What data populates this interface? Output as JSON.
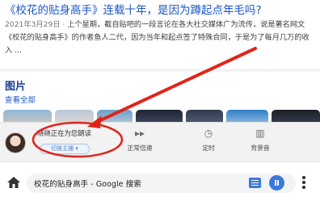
{
  "result": {
    "title": "《校花的贴身高手》连载十年，是因为蹲起点年毛吗?",
    "date": "2021年3月29日 ·",
    "snippet": " 上个星期，截自贴吧的一段言论在各大社交媒体广为流传，说是著名网文《校花的贴身高手》的作者鱼人二代，因为当年和起点签了特殊合同，于是为了每月几万的收入 ..."
  },
  "images": {
    "heading": "图片",
    "view_all": "查看全部"
  },
  "player": {
    "narrator_text": "晓晓正在为您朗读",
    "switch_label": "切换主播 ▾",
    "controls": [
      {
        "icon": "fast-forward-icon",
        "glyph": "▸▸",
        "label": "正常倍速"
      },
      {
        "icon": "timer-icon",
        "glyph": "◷",
        "label": "定时"
      },
      {
        "icon": "background-music-icon",
        "glyph": "▥",
        "label": "背景音"
      }
    ]
  },
  "toolbar": {
    "omnibox_text": "校花的贴身高手 - Google 搜索"
  },
  "colors": {
    "link": "#1a56c6",
    "accent": "#3b78d8",
    "annotation": "#e0241b"
  }
}
